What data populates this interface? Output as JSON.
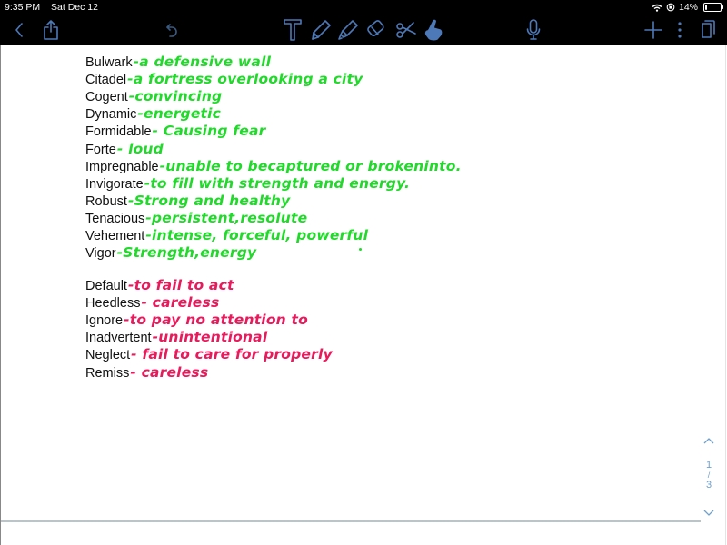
{
  "status_bar": {
    "time": "9:35 PM",
    "date": "Sat Dec 12",
    "battery": "14%",
    "battery_level": 0.14,
    "icons": [
      "wifi-icon",
      "orientation-lock-icon",
      "battery-icon"
    ]
  },
  "toolbar": {
    "left": [
      {
        "name": "back-button",
        "icon": "chevron-left-icon"
      },
      {
        "name": "share-button",
        "icon": "share-icon"
      },
      {
        "name": "undo-button",
        "icon": "undo-icon"
      }
    ],
    "tools": [
      {
        "name": "text-tool",
        "icon": "text-icon"
      },
      {
        "name": "pen-tool",
        "icon": "pen-icon"
      },
      {
        "name": "highlighter-tool",
        "icon": "highlighter-icon"
      },
      {
        "name": "eraser-tool",
        "icon": "eraser-icon"
      },
      {
        "name": "scissors-tool",
        "icon": "scissors-icon"
      },
      {
        "name": "pointer-tool",
        "icon": "hand-pointer-icon",
        "active": true
      }
    ],
    "right": [
      {
        "name": "microphone-button",
        "icon": "microphone-icon"
      },
      {
        "name": "add-button",
        "icon": "plus-icon"
      },
      {
        "name": "more-button",
        "icon": "more-vertical-icon"
      },
      {
        "name": "pages-button",
        "icon": "pages-icon"
      }
    ],
    "accent_color": "#4d79b8"
  },
  "notes": {
    "group1_color": "#21d92a",
    "group2_color": "#e8195c",
    "group1": [
      {
        "term": "Bulwark",
        "definition": "-a defensive wall"
      },
      {
        "term": "Citadel",
        "definition": "-a fortress overlooking a city"
      },
      {
        "term": "Cogent",
        "definition": "-convincing"
      },
      {
        "term": "Dynamic",
        "definition": "-energetic"
      },
      {
        "term": "Formidable",
        "definition": "- Causing fear"
      },
      {
        "term": "Forte",
        "definition": "- loud"
      },
      {
        "term": "Impregnable",
        "definition": "-unable to becaptured or brokeninto."
      },
      {
        "term": "Invigorate",
        "definition": "-to fill with strength and energy."
      },
      {
        "term": "Robust",
        "definition": "-Strong and healthy"
      },
      {
        "term": "Tenacious",
        "definition": "-persistent,resolute"
      },
      {
        "term": "Vehement",
        "definition": "-intense, forceful, powerful"
      },
      {
        "term": "Vigor",
        "definition": "-Strength,energy"
      }
    ],
    "group2": [
      {
        "term": "Default",
        "definition": "-to fail to act"
      },
      {
        "term": "Heedless",
        "definition": "- careless"
      },
      {
        "term": "Ignore",
        "definition": "-to pay no attention to"
      },
      {
        "term": "Inadvertent",
        "definition": "-unintentional"
      },
      {
        "term": "Neglect",
        "definition": "- fail to care for properly"
      },
      {
        "term": "Remiss",
        "definition": "- careless"
      }
    ]
  },
  "pager": {
    "current": "1",
    "separator": "/",
    "total": "3",
    "up_icon": "chevron-up-icon",
    "down_icon": "chevron-down-icon"
  }
}
